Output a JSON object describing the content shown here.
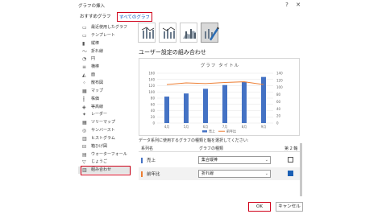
{
  "window": {
    "title": "グラフの挿入",
    "help_glyph": "?",
    "close_glyph": "✕"
  },
  "tabs": [
    {
      "label": "おすすめグラフ",
      "active": false
    },
    {
      "label": "すべてのグラフ",
      "active": true
    }
  ],
  "sidebar": {
    "items": [
      {
        "label": "最近使用したグラフ",
        "icon": "folder-icon"
      },
      {
        "label": "テンプレート",
        "icon": "template-folder-icon"
      },
      {
        "label": "縦棒",
        "icon": "column-chart-icon"
      },
      {
        "label": "折れ線",
        "icon": "line-chart-icon"
      },
      {
        "label": "円",
        "icon": "pie-chart-icon"
      },
      {
        "label": "横棒",
        "icon": "bar-chart-icon"
      },
      {
        "label": "面",
        "icon": "area-chart-icon"
      },
      {
        "label": "散布図",
        "icon": "scatter-chart-icon"
      },
      {
        "label": "マップ",
        "icon": "map-chart-icon"
      },
      {
        "label": "株価",
        "icon": "stock-chart-icon"
      },
      {
        "label": "等高線",
        "icon": "surface-chart-icon"
      },
      {
        "label": "レーダー",
        "icon": "radar-chart-icon"
      },
      {
        "label": "ツリーマップ",
        "icon": "treemap-chart-icon"
      },
      {
        "label": "サンバースト",
        "icon": "sunburst-chart-icon"
      },
      {
        "label": "ヒストグラム",
        "icon": "histogram-chart-icon"
      },
      {
        "label": "箱ひげ図",
        "icon": "boxwhisker-chart-icon"
      },
      {
        "label": "ウォーターフォール",
        "icon": "waterfall-chart-icon"
      },
      {
        "label": "じょうご",
        "icon": "funnel-chart-icon"
      },
      {
        "label": "組み合わせ",
        "icon": "combo-chart-icon",
        "selected": true
      }
    ]
  },
  "combo_types": [
    "custom-combo-1",
    "custom-combo-2",
    "custom-combo-3",
    "custom-combo-4"
  ],
  "section_title": "ユーザー設定の組み合わせ",
  "preview": {
    "title": "グラフ タイトル",
    "legend": [
      "売上",
      "前年比"
    ],
    "colors": {
      "bar": "#4472c4",
      "line": "#ed7d31"
    }
  },
  "chart_data": {
    "type": "bar",
    "title": "グラフ タイトル",
    "categories": [
      "4月",
      "5月",
      "6月",
      "7月",
      "8月",
      "9月"
    ],
    "series": [
      {
        "name": "売上",
        "type": "bar",
        "axis": "primary",
        "values": [
          85,
          95,
          110,
          122,
          133,
          148
        ]
      },
      {
        "name": "前年比",
        "type": "line",
        "axis": "secondary",
        "values": [
          108,
          113,
          111,
          114,
          116,
          108
        ]
      }
    ],
    "ylim": [
      0,
      160
    ],
    "y_ticks": [
      0,
      20,
      40,
      60,
      80,
      100,
      120,
      140,
      160
    ],
    "y2lim": [
      0,
      140
    ],
    "y2_ticks": [
      0,
      20,
      40,
      60,
      80,
      100,
      120,
      140
    ],
    "legend_position": "bottom",
    "grid": true
  },
  "series_grid": {
    "hint": "データ系列に使用するグラフの種類と軸を選択してください:",
    "headers": {
      "name": "系列名",
      "type": "グラフの種類",
      "axis2": "第 2 軸"
    },
    "rows": [
      {
        "name": "売上",
        "color": "#4472c4",
        "chart_type": "集合縦棒",
        "secondary": false
      },
      {
        "name": "前年比",
        "color": "#ed7d31",
        "chart_type": "折れ線",
        "secondary": true
      }
    ]
  },
  "buttons": {
    "ok": "OK",
    "cancel": "キャンセル"
  }
}
